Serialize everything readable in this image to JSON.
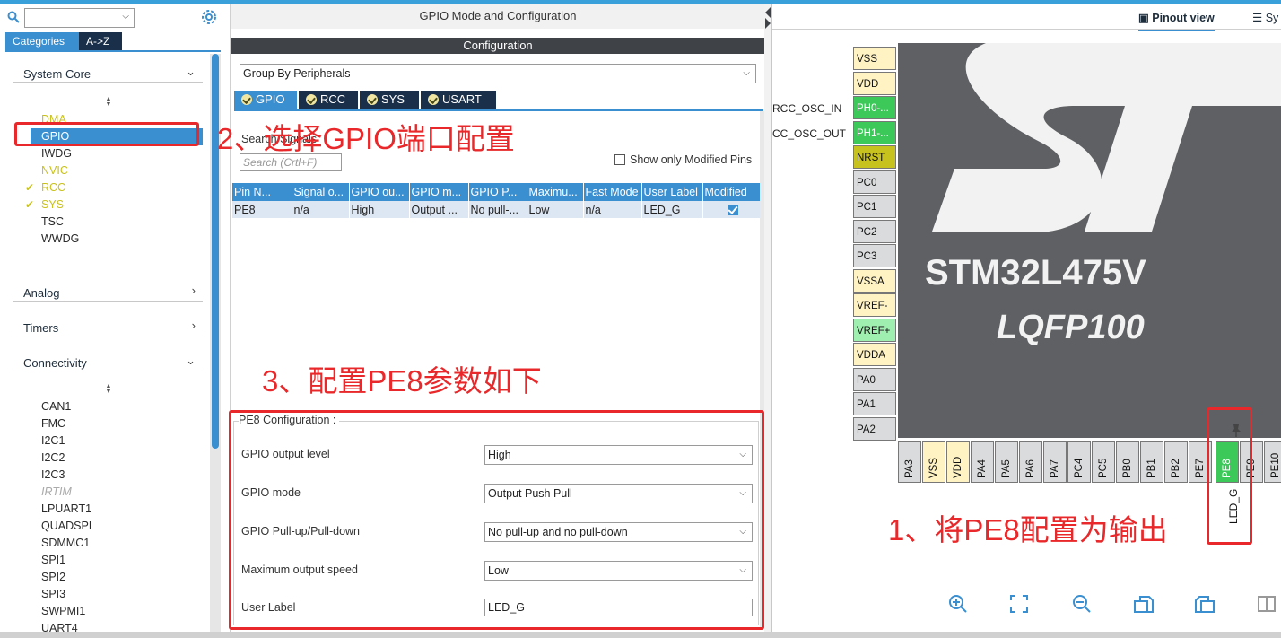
{
  "left": {
    "search_value": "",
    "tabs": [
      "Categories",
      "A->Z"
    ],
    "categories": {
      "system_core": "System Core",
      "system_core_items": [
        {
          "label": "DMA",
          "style": "yellow"
        },
        {
          "label": "GPIO",
          "style": "selected"
        },
        {
          "label": "IWDG",
          "style": "normal"
        },
        {
          "label": "NVIC",
          "style": "yellow"
        },
        {
          "label": "RCC",
          "style": "checked"
        },
        {
          "label": "SYS",
          "style": "checked"
        },
        {
          "label": "TSC",
          "style": "normal"
        },
        {
          "label": "WWDG",
          "style": "normal"
        }
      ],
      "analog": "Analog",
      "timers": "Timers",
      "connectivity": "Connectivity",
      "connectivity_items": [
        {
          "label": "CAN1",
          "style": "normal"
        },
        {
          "label": "FMC",
          "style": "normal"
        },
        {
          "label": "I2C1",
          "style": "normal"
        },
        {
          "label": "I2C2",
          "style": "normal"
        },
        {
          "label": "I2C3",
          "style": "normal"
        },
        {
          "label": "IRTIM",
          "style": "muted"
        },
        {
          "label": "LPUART1",
          "style": "normal"
        },
        {
          "label": "QUADSPI",
          "style": "normal"
        },
        {
          "label": "SDMMC1",
          "style": "normal"
        },
        {
          "label": "SPI1",
          "style": "normal"
        },
        {
          "label": "SPI2",
          "style": "normal"
        },
        {
          "label": "SPI3",
          "style": "normal"
        },
        {
          "label": "SWPMI1",
          "style": "normal"
        },
        {
          "label": "UART4",
          "style": "normal"
        }
      ]
    }
  },
  "annotations": {
    "step1": "1、将PE8配置为输出",
    "step2": "2、选择GPIO端口配置",
    "step3": "3、配置PE8参数如下"
  },
  "mid": {
    "title": "GPIO Mode and Configuration",
    "configuration": "Configuration",
    "group_by": "Group By Peripherals",
    "tabs": [
      "GPIO",
      "RCC",
      "SYS",
      "USART"
    ],
    "search_signals_label": "Search Signals",
    "search_signals_placeholder": "Search (Crtl+F)",
    "show_only_modified": "Show only Modified Pins",
    "table": {
      "headers": [
        "Pin N...",
        "Signal o...",
        "GPIO ou...",
        "GPIO m...",
        "GPIO P...",
        "Maximu...",
        "Fast Mode",
        "User Label",
        "Modified"
      ],
      "rows": [
        [
          "PE8",
          "n/a",
          "High",
          "Output ...",
          "No pull-...",
          "Low",
          "n/a",
          "LED_G",
          ""
        ]
      ]
    },
    "pe8_config": {
      "legend": "PE8 Configuration :",
      "rows": [
        {
          "label": "GPIO output level",
          "value": "High"
        },
        {
          "label": "GPIO mode",
          "value": "Output Push Pull"
        },
        {
          "label": "GPIO Pull-up/Pull-down",
          "value": "No pull-up and no pull-down"
        },
        {
          "label": "Maximum output speed",
          "value": "Low"
        },
        {
          "label": "User Label",
          "value": "LED_G"
        }
      ]
    }
  },
  "right": {
    "tabs": [
      "Pinout view",
      "Sy"
    ],
    "chip_name": "STM32L475V",
    "package": "LQFP100",
    "signal_labels": [
      "RCC_OSC_IN",
      "CC_OSC_OUT"
    ],
    "left_pins": [
      {
        "label": "VSS",
        "style": "pwr"
      },
      {
        "label": "VDD",
        "style": "pwr"
      },
      {
        "label": "PH0-...",
        "style": "green"
      },
      {
        "label": "PH1-...",
        "style": "green"
      },
      {
        "label": "NRST",
        "style": "olive"
      },
      {
        "label": "PC0",
        "style": "gray"
      },
      {
        "label": "PC1",
        "style": "gray"
      },
      {
        "label": "PC2",
        "style": "gray"
      },
      {
        "label": "PC3",
        "style": "gray"
      },
      {
        "label": "VSSA",
        "style": "pwr"
      },
      {
        "label": "VREF-",
        "style": "pwr"
      },
      {
        "label": "VREF+",
        "style": "lgreen"
      },
      {
        "label": "VDDA",
        "style": "pwr"
      },
      {
        "label": "PA0",
        "style": "gray"
      },
      {
        "label": "PA1",
        "style": "gray"
      },
      {
        "label": "PA2",
        "style": "gray"
      }
    ],
    "bottom_pins": [
      {
        "label": "PA3",
        "style": "gray"
      },
      {
        "label": "VSS",
        "style": "pwr"
      },
      {
        "label": "VDD",
        "style": "pwr"
      },
      {
        "label": "PA4",
        "style": "gray"
      },
      {
        "label": "PA5",
        "style": "gray"
      },
      {
        "label": "PA6",
        "style": "gray"
      },
      {
        "label": "PA7",
        "style": "gray"
      },
      {
        "label": "PC4",
        "style": "gray"
      },
      {
        "label": "PC5",
        "style": "gray"
      },
      {
        "label": "PB0",
        "style": "gray"
      },
      {
        "label": "PB1",
        "style": "gray"
      },
      {
        "label": "PB2",
        "style": "gray"
      },
      {
        "label": "PE7",
        "style": "gray"
      },
      {
        "label": "PE8",
        "style": "green"
      },
      {
        "label": "PE9",
        "style": "gray"
      },
      {
        "label": "PE10",
        "style": "gray"
      }
    ],
    "pe8_user_label": "LED_G",
    "toolbar_icons": [
      "zoom-in-icon",
      "fit-screen-icon",
      "zoom-out-icon",
      "rotate-right-icon",
      "rotate-left-icon",
      "split-view-icon"
    ]
  }
}
